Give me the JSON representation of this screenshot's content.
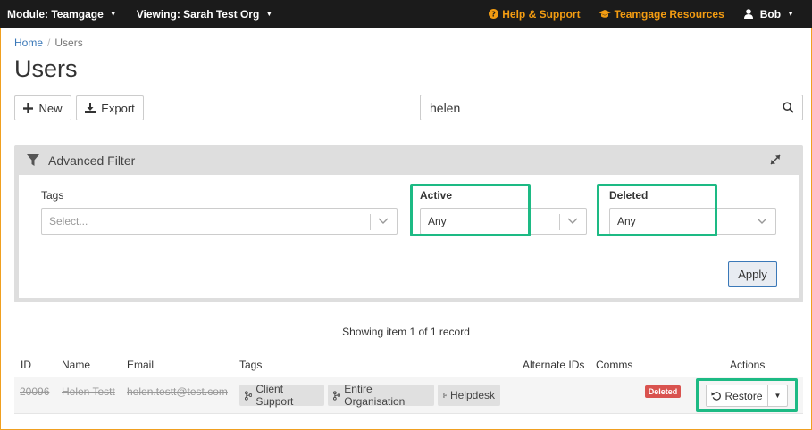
{
  "topbar": {
    "module_label": "Module: Teamgage",
    "viewing_label": "Viewing: Sarah Test Org",
    "help_label": "Help & Support",
    "resources_label": "Teamgage Resources",
    "user_label": "Bob"
  },
  "breadcrumb": {
    "home": "Home",
    "separator": "/",
    "current": "Users"
  },
  "page": {
    "title": "Users"
  },
  "toolbar": {
    "new_label": "New",
    "export_label": "Export"
  },
  "search": {
    "value": "helen"
  },
  "filter": {
    "title": "Advanced Filter",
    "tags_label": "Tags",
    "tags_placeholder": "Select...",
    "active_label": "Active",
    "active_value": "Any",
    "deleted_label": "Deleted",
    "deleted_value": "Any",
    "apply_label": "Apply"
  },
  "results": {
    "summary": "Showing item 1 of 1 record"
  },
  "table": {
    "columns": [
      "ID",
      "Name",
      "Email",
      "Tags",
      "Alternate IDs",
      "Comms",
      "Actions"
    ],
    "rows": [
      {
        "id": "20096",
        "name": "Helen Testt",
        "email": "helen.testt@test.com",
        "tags": [
          "Client Support",
          "Entire Organisation",
          "Helpdesk"
        ],
        "status": "Deleted",
        "action_label": "Restore"
      }
    ]
  },
  "colors": {
    "highlight": "#1dba84",
    "topbar": "#1b1b1b",
    "link": "#f39c12",
    "deleted_badge": "#d9534f"
  },
  "icons": [
    "chevron-down-icon",
    "help-icon",
    "graduation-cap-icon",
    "user-icon",
    "plus-icon",
    "download-icon",
    "search-icon",
    "filter-icon",
    "expand-icon",
    "tag-icon",
    "undo-icon"
  ]
}
